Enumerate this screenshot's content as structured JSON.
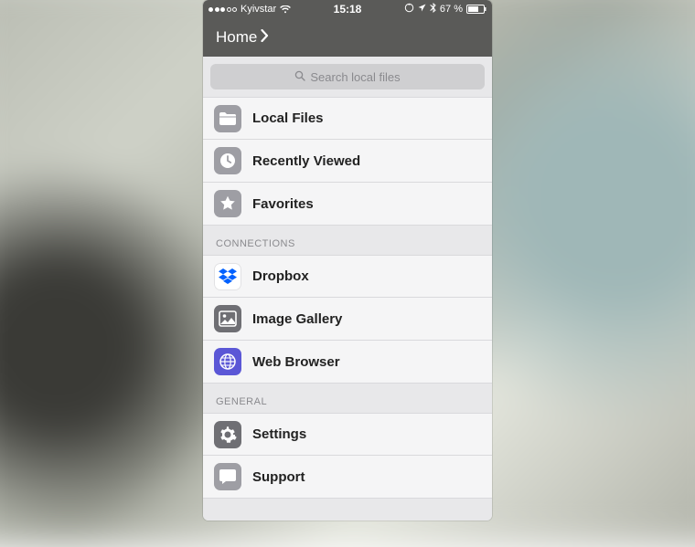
{
  "status": {
    "signal_filled": 3,
    "signal_total": 5,
    "carrier": "Kyivstar",
    "time": "15:18",
    "battery_pct": "67 %"
  },
  "nav": {
    "title": "Home"
  },
  "search": {
    "placeholder": "Search local files"
  },
  "sections": [
    {
      "header": null,
      "items": [
        {
          "icon": "folder-icon",
          "label": "Local Files",
          "bg": "icon-gray"
        },
        {
          "icon": "clock-icon",
          "label": "Recently Viewed",
          "bg": "icon-gray"
        },
        {
          "icon": "star-icon",
          "label": "Favorites",
          "bg": "icon-gray"
        }
      ]
    },
    {
      "header": "CONNECTIONS",
      "items": [
        {
          "icon": "dropbox-icon",
          "label": "Dropbox",
          "bg": "icon-white"
        },
        {
          "icon": "image-icon",
          "label": "Image Gallery",
          "bg": "icon-darkgray"
        },
        {
          "icon": "globe-icon",
          "label": "Web Browser",
          "bg": "icon-indigo"
        }
      ]
    },
    {
      "header": "GENERAL",
      "items": [
        {
          "icon": "gear-icon",
          "label": "Settings",
          "bg": "icon-darkgray"
        },
        {
          "icon": "chat-icon",
          "label": "Support",
          "bg": "icon-gray"
        }
      ]
    }
  ]
}
